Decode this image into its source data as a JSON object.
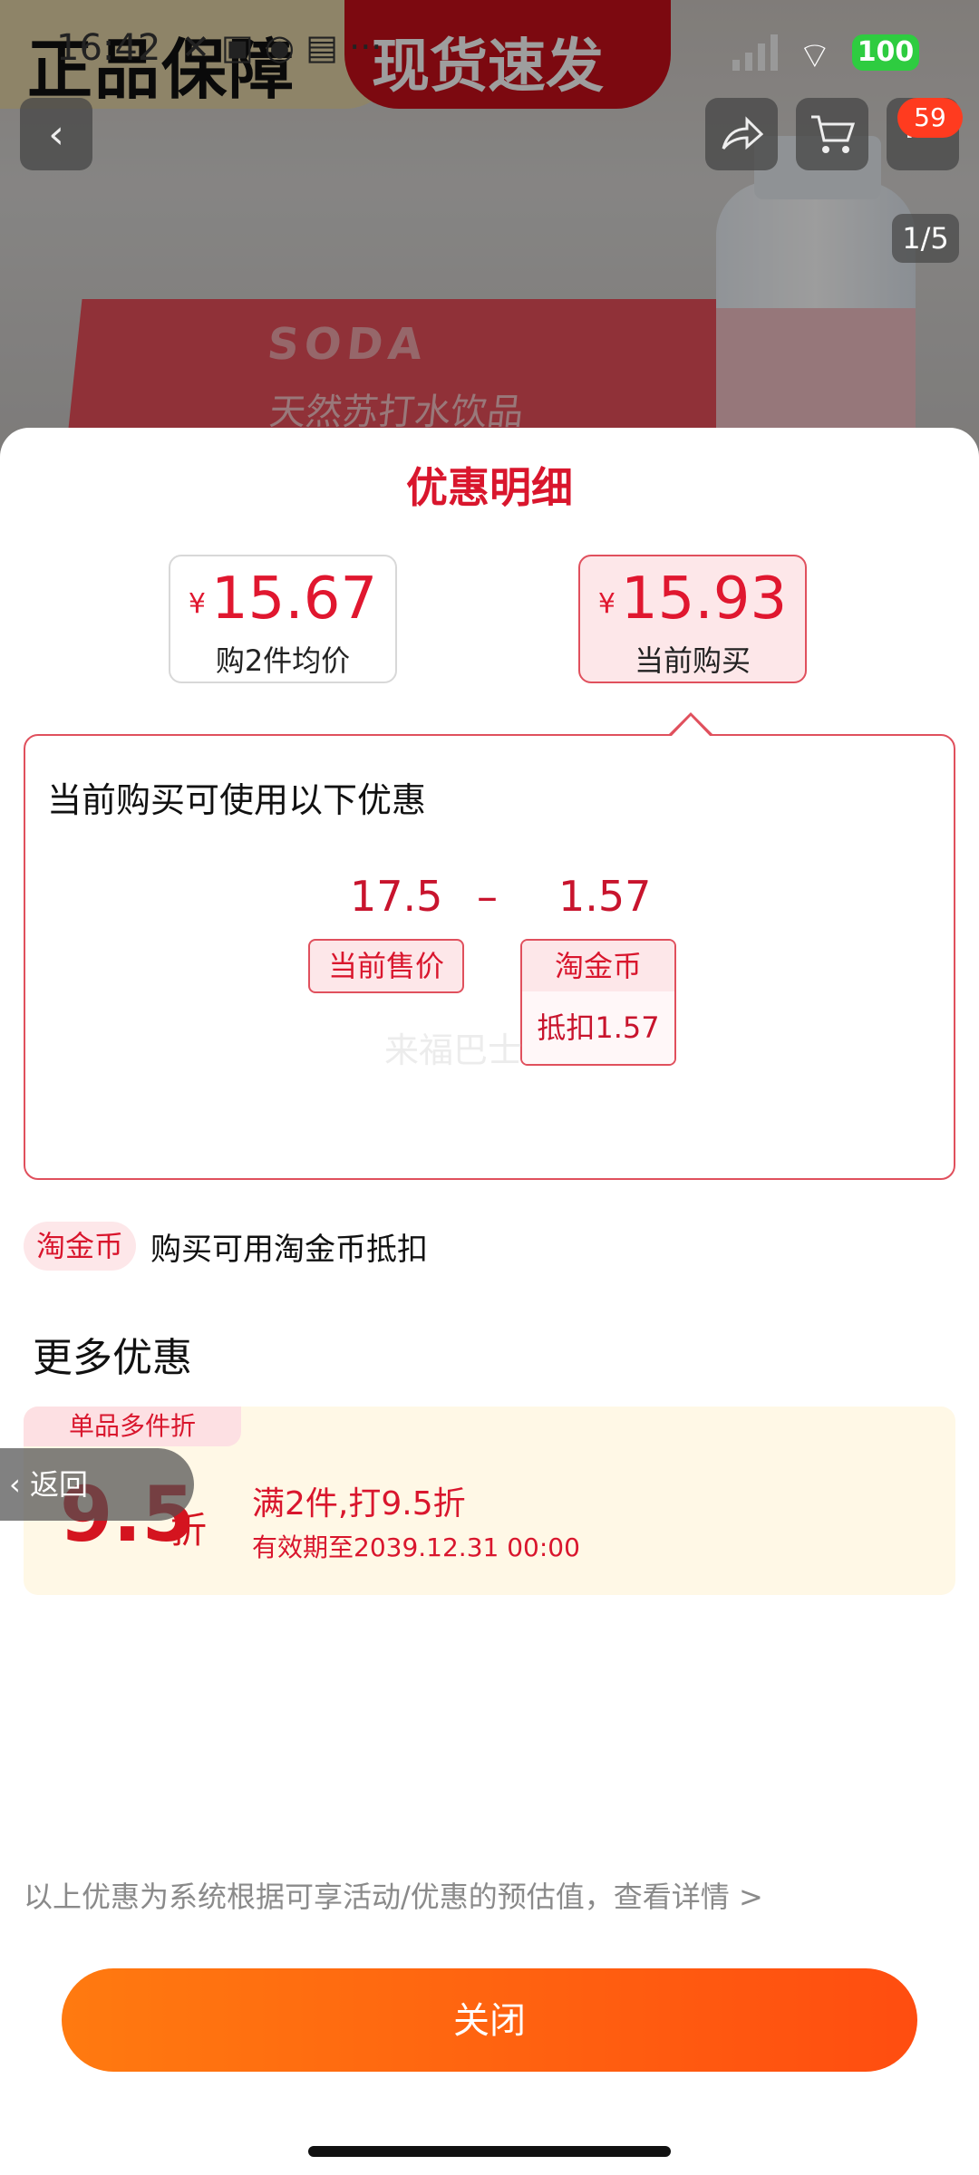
{
  "banner": {
    "left_text": "正品保障",
    "right_text": "现货速发"
  },
  "status_bar": {
    "time": "16:42",
    "battery": "100"
  },
  "header": {
    "cart_badge": "59",
    "image_pager": "1/5"
  },
  "product_image": {
    "brand_text": "SODA",
    "box_text": "天然苏打水饮品"
  },
  "sheet": {
    "title": "优惠明细",
    "price_cards": [
      {
        "currency": "¥",
        "price": "15.67",
        "label": "购2件均价"
      },
      {
        "currency": "¥",
        "price": "15.93",
        "label": "当前购买"
      }
    ],
    "detail": {
      "heading": "当前购买可使用以下优惠",
      "sale_price": "17.5",
      "minus": "–",
      "deduction": "1.57",
      "sale_tag": "当前售价",
      "coin_tag_top": "淘金币",
      "coin_tag_bottom": "抵扣1.57",
      "watermark": "来福巴士"
    },
    "coin_row": {
      "tag": "淘金币",
      "text": "购买可用淘金币抵扣"
    },
    "more_title": "更多优惠",
    "discount_card": {
      "corner": "单品多件折",
      "big": "9.5",
      "unit": "折",
      "line1": "满2件,打9.5折",
      "line2": "有效期至2039.12.31 00:00"
    },
    "back_label": "返回",
    "footer_note": "以上优惠为系统根据可享活动/优惠的预估值，查看详情 >",
    "close_label": "关闭"
  },
  "colors": {
    "accent": "#d9162d",
    "button": "#ff6a10",
    "card_bg": "#fff8e6"
  }
}
